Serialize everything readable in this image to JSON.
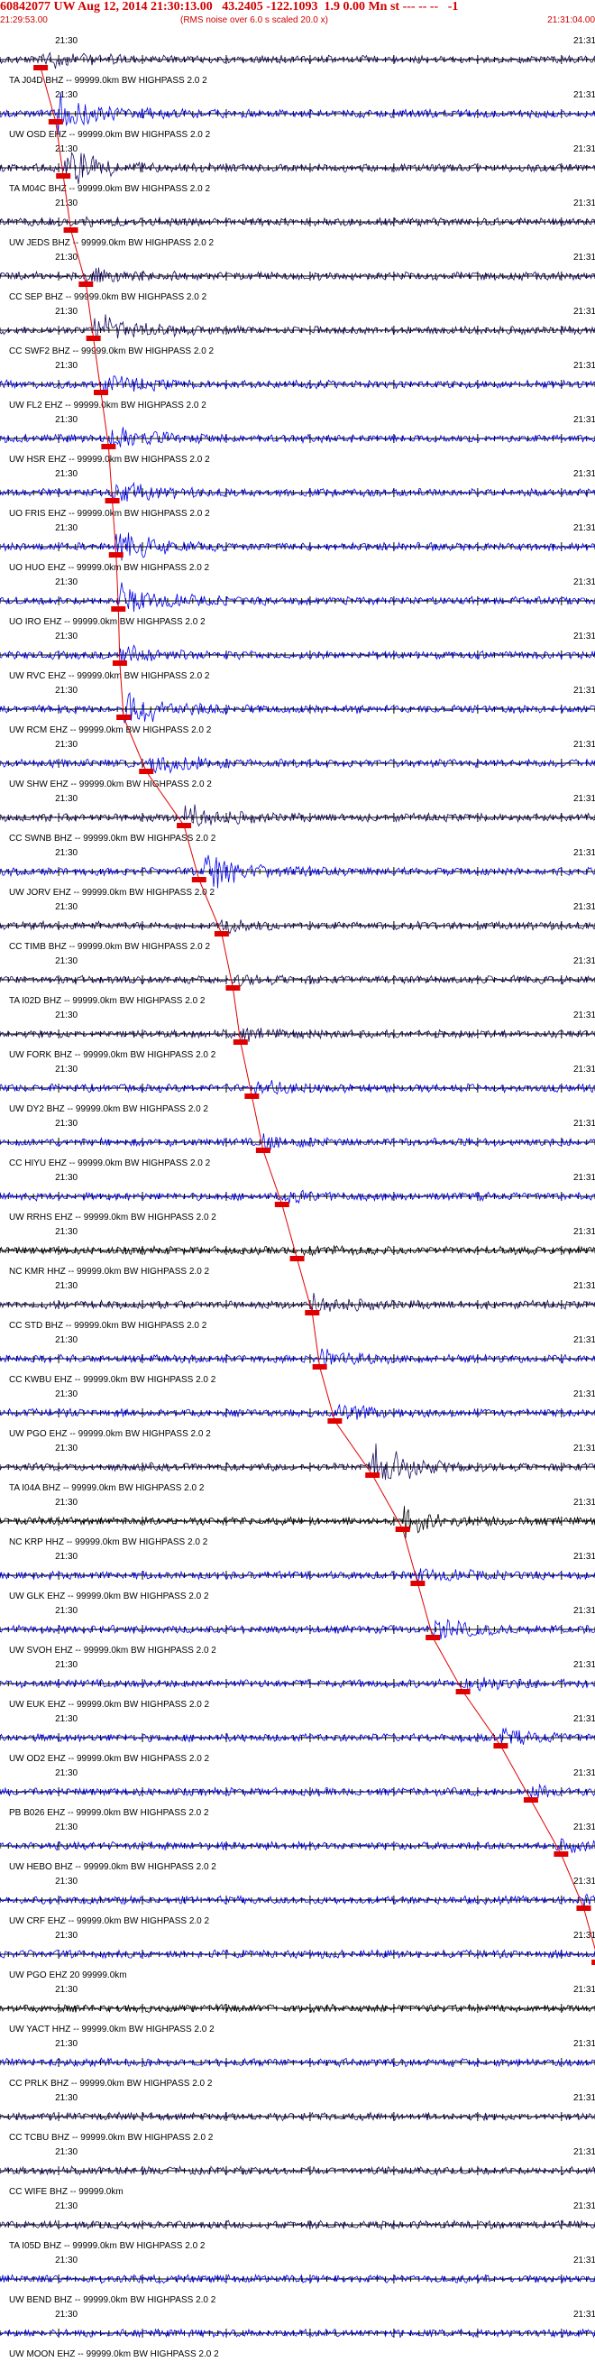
{
  "header": {
    "title": "60842077 UW Aug 12, 2014 21:30:13.00   43.2405 -122.1093  1.9 0.00 Mn st --- -- --   -1",
    "start_time": "21:29:53.00",
    "rms_note": "(RMS noise over 6.0 s scaled 20.0 x)",
    "end_time": "21:31:04.00"
  },
  "colors": {
    "title": "#d00000",
    "pick": "#e00000",
    "trace_blue": "#0000ee",
    "trace_navy": "#1a0a5e",
    "trace_black": "#000000",
    "axis": "#000000"
  },
  "chart_data": {
    "type": "line",
    "title": "60842077 UW Aug 12, 2014 21:30:13.00   43.2405 -122.1093  1.9 0.00 Mn st --- -- --   -1",
    "x_range": [
      "21:29:53.00",
      "21:31:04.00"
    ],
    "x_ticks": [
      "21:30",
      "21:31"
    ],
    "ylabel": "",
    "series": [
      {
        "name": "TA J04D BHZ -- 99999.0km BW  HIGHPASS  2.0  2",
        "pick_sec": 23.0,
        "signal": "navy",
        "amp": 0.4
      },
      {
        "name": "UW OSD EHZ -- 99999.0km BW  HIGHPASS  2.0  2",
        "pick_sec": 25.0,
        "signal": "blue",
        "amp": 1.0
      },
      {
        "name": "TA M04C BHZ -- 99999.0km BW  HIGHPASS  2.0  2",
        "pick_sec": 26.0,
        "signal": "navy",
        "amp": 0.8
      },
      {
        "name": "UW JEDS BHZ -- 99999.0km BW  HIGHPASS  2.0  2",
        "pick_sec": 27.0,
        "signal": "navy",
        "amp": 0.1
      },
      {
        "name": "CC SEP BHZ -- 99999.0km BW  HIGHPASS  2.0  2",
        "pick_sec": 29.0,
        "signal": "navy",
        "amp": 0.3
      },
      {
        "name": "CC SWF2 BHZ -- 99999.0km BW  HIGHPASS  2.0  2",
        "pick_sec": 30.0,
        "signal": "navy",
        "amp": 0.8
      },
      {
        "name": "UW FL2 EHZ -- 99999.0km BW  HIGHPASS  2.0  2",
        "pick_sec": 31.0,
        "signal": "blue",
        "amp": 0.4
      },
      {
        "name": "UW HSR EHZ -- 99999.0km BW  HIGHPASS  2.0  2",
        "pick_sec": 32.0,
        "signal": "blue",
        "amp": 0.6
      },
      {
        "name": "UO FRIS EHZ -- 99999.0km BW  HIGHPASS  2.0  2",
        "pick_sec": 32.5,
        "signal": "blue",
        "amp": 0.5
      },
      {
        "name": "UO HUO EHZ -- 99999.0km BW  HIGHPASS  2.0  2",
        "pick_sec": 33.0,
        "signal": "blue",
        "amp": 0.7
      },
      {
        "name": "UO IRO EHZ -- 99999.0km BW  HIGHPASS  2.0  2",
        "pick_sec": 33.3,
        "signal": "blue",
        "amp": 0.8
      },
      {
        "name": "UW RVC EHZ -- 99999.0km BW  HIGHPASS  2.0  2",
        "pick_sec": 33.5,
        "signal": "blue",
        "amp": 0.4
      },
      {
        "name": "UW RCM EHZ -- 99999.0km BW  HIGHPASS  2.0  2",
        "pick_sec": 34.0,
        "signal": "blue",
        "amp": 1.0
      },
      {
        "name": "UW SHW EHZ -- 99999.0km BW  HIGHPASS  2.0  2",
        "pick_sec": 37.0,
        "signal": "blue",
        "amp": 0.6
      },
      {
        "name": "CC SWNB BHZ -- 99999.0km BW  HIGHPASS  2.0  2",
        "pick_sec": 42.0,
        "signal": "navy",
        "amp": 0.6
      },
      {
        "name": "UW JORV EHZ -- 99999.0km BW  HIGHPASS  2.0  2",
        "pick_sec": 44.0,
        "signal": "blue",
        "amp": 1.0
      },
      {
        "name": "CC TIMB BHZ -- 99999.0km BW  HIGHPASS  2.0  2",
        "pick_sec": 47.0,
        "signal": "navy",
        "amp": 0.3
      },
      {
        "name": "TA I02D BHZ -- 99999.0km BW  HIGHPASS  2.0  2",
        "pick_sec": 48.5,
        "signal": "navy",
        "amp": 0.2
      },
      {
        "name": "UW FORK BHZ -- 99999.0km BW  HIGHPASS  2.0  2",
        "pick_sec": 49.5,
        "signal": "navy",
        "amp": 0.2
      },
      {
        "name": "UW DY2 BHZ -- 99999.0km BW  HIGHPASS  2.0  2",
        "pick_sec": 51.0,
        "signal": "blue",
        "amp": 0.3
      },
      {
        "name": "CC HIYU EHZ -- 99999.0km BW  HIGHPASS  2.0  2",
        "pick_sec": 52.5,
        "signal": "blue",
        "amp": 0.3
      },
      {
        "name": "UW RRHS EHZ -- 99999.0km BW  HIGHPASS  2.0  2",
        "pick_sec": 55.0,
        "signal": "blue",
        "amp": 0.2
      },
      {
        "name": "NC KMR HHZ -- 99999.0km BW  HIGHPASS  2.0  2",
        "pick_sec": 57.0,
        "signal": "black",
        "amp": 0.2
      },
      {
        "name": "CC STD BHZ -- 99999.0km BW  HIGHPASS  2.0  2",
        "pick_sec": 59.0,
        "signal": "navy",
        "amp": 0.4
      },
      {
        "name": "CC KWBU EHZ -- 99999.0km BW  HIGHPASS  2.0  2",
        "pick_sec": 60.0,
        "signal": "blue",
        "amp": 0.4
      },
      {
        "name": "UW PGO EHZ -- 99999.0km BW  HIGHPASS  2.0  2",
        "pick_sec": 62.0,
        "signal": "blue",
        "amp": 0.4
      },
      {
        "name": "TA I04A BHZ -- 99999.0km BW  HIGHPASS  2.0  2",
        "pick_sec": 67.0,
        "signal": "navy",
        "amp": 1.0
      },
      {
        "name": "NC KRP HHZ -- 99999.0km BW  HIGHPASS  2.0  2",
        "pick_sec": 71.0,
        "signal": "black",
        "amp": 0.6
      },
      {
        "name": "UW GLK EHZ -- 99999.0km BW  HIGHPASS  2.0  2",
        "pick_sec": 73.0,
        "signal": "blue",
        "amp": 0.3
      },
      {
        "name": "UW SVOH EHZ -- 99999.0km BW  HIGHPASS  2.0  2",
        "pick_sec": 75.0,
        "signal": "blue",
        "amp": 0.5
      },
      {
        "name": "UW EUK EHZ -- 99999.0km BW  HIGHPASS  2.0  2",
        "pick_sec": 79.0,
        "signal": "blue",
        "amp": 0.4
      },
      {
        "name": "UW OD2 EHZ -- 99999.0km BW  HIGHPASS  2.0  2",
        "pick_sec": 84.0,
        "signal": "blue",
        "amp": 0.3
      },
      {
        "name": "PB B026 EHZ -- 99999.0km BW  HIGHPASS  2.0  2",
        "pick_sec": 88.0,
        "signal": "blue",
        "amp": 0.2
      },
      {
        "name": "UW HEBO BHZ -- 99999.0km BW  HIGHPASS  2.0  2",
        "pick_sec": 92.0,
        "signal": "blue",
        "amp": 0.2
      },
      {
        "name": "UW CRF EHZ -- 99999.0km BW  HIGHPASS  2.0  2",
        "pick_sec": 95.0,
        "signal": "blue",
        "amp": 0.2
      },
      {
        "name": "UW PGO EHZ 20 99999.0km",
        "pick_sec": 97.0,
        "signal": "blue",
        "amp": 0.2
      },
      {
        "name": "UW YACT HHZ -- 99999.0km BW  HIGHPASS  2.0  2",
        "pick_sec": null,
        "signal": "black",
        "amp": 0.2
      },
      {
        "name": "CC PRLK BHZ -- 99999.0km BW  HIGHPASS  2.0  2",
        "pick_sec": null,
        "signal": "blue",
        "amp": 0.1
      },
      {
        "name": "CC TCBU BHZ -- 99999.0km BW  HIGHPASS  2.0  2",
        "pick_sec": null,
        "signal": "navy",
        "amp": 0.1
      },
      {
        "name": "CC WIFE BHZ -- 99999.0km",
        "pick_sec": null,
        "signal": "navy",
        "amp": 0.1
      },
      {
        "name": "TA I05D BHZ -- 99999.0km BW  HIGHPASS  2.0  2",
        "pick_sec": null,
        "signal": "navy",
        "amp": 0.1
      },
      {
        "name": "UW BEND BHZ -- 99999.0km BW  HIGHPASS  2.0  2",
        "pick_sec": null,
        "signal": "blue",
        "amp": 0.1
      },
      {
        "name": "UW MOON EHZ -- 99999.0km BW  HIGHPASS  2.0  2",
        "pick_sec": null,
        "signal": "blue",
        "amp": 0.1
      }
    ]
  }
}
